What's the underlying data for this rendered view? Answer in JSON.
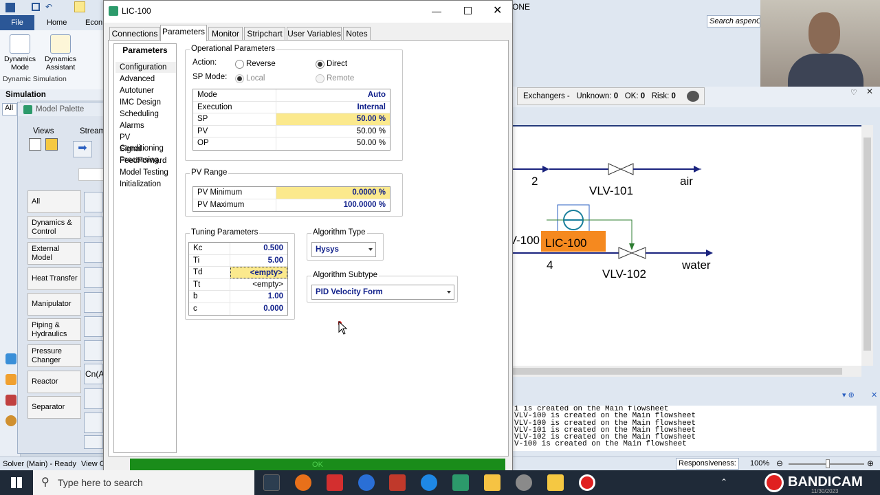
{
  "ribbon": {
    "file_tab": "File",
    "home_tab": "Home",
    "econ_tab": "Econ",
    "dynamics_mode": "Dynamics Mode",
    "dynamics_assistant": "Dynamics Assistant",
    "dynamic_simulation": "Dynamic Simulation"
  },
  "simulation_label": "Simulation",
  "left_filter": "All",
  "palette": {
    "title": "Model Palette",
    "views_label": "Views",
    "streams_label": "Stream",
    "categories": [
      "All",
      "Dynamics & Control",
      "External Model",
      "Heat Transfer",
      "Manipulator",
      "Piping & Hydraulics",
      "Pressure Changer",
      "Reactor",
      "Separator"
    ],
    "cn_label": "Cn(A"
  },
  "status_left": {
    "solver": "Solver (Main) - Ready",
    "view": "View C"
  },
  "app_title_fragment": "ONE",
  "search_box": "Search aspenO",
  "exchangers_bar": {
    "label": "Exchangers -",
    "unknown": "Unknown:",
    "unknown_val": "0",
    "ok": "OK:",
    "ok_val": "0",
    "risk": "Risk:",
    "risk_val": "0"
  },
  "flowsheet": {
    "stream2": "2",
    "vlv101": "VLV-101",
    "air": "air",
    "v100": "V-100",
    "lic100": "LIC-100",
    "stream4": "4",
    "vlv102": "VLV-102",
    "water": "water"
  },
  "messages": [
    "1 is created on the Main flowsheet",
    "VLV-100 is created on the Main flowsheet",
    "VLV-100 is created on the Main flowsheet",
    "VLV-101 is created on the Main flowsheet",
    "VLV-102 is created on the Main flowsheet",
    "V-100 is created on the Main flowsheet"
  ],
  "fs_status": {
    "responsiveness": "Responsiveness: 5",
    "zoom": "100%"
  },
  "dialog": {
    "title": "LIC-100",
    "tabs": [
      "Connections",
      "Parameters",
      "Monitor",
      "Stripchart",
      "User Variables",
      "Notes"
    ],
    "left_title": "Parameters",
    "left_items": [
      "Configuration",
      "Advanced",
      "Autotuner",
      "IMC Design",
      "Scheduling",
      "Alarms",
      "PV Conditioning",
      "Signal Processing",
      "FeedForward",
      "Model Testing",
      "Initialization"
    ],
    "op_params": {
      "title": "Operational Parameters",
      "action_label": "Action:",
      "reverse": "Reverse",
      "direct": "Direct",
      "sp_mode_label": "SP Mode:",
      "local": "Local",
      "remote": "Remote",
      "rows": [
        {
          "k": "Mode",
          "v": "Auto"
        },
        {
          "k": "Execution",
          "v": "Internal"
        },
        {
          "k": "SP",
          "v": "50.00 %"
        },
        {
          "k": "PV",
          "v": "50.00 %"
        },
        {
          "k": "OP",
          "v": "50.00 %"
        }
      ]
    },
    "pv_range": {
      "title": "PV Range",
      "rows": [
        {
          "k": "PV Minimum",
          "v": "0.0000 %"
        },
        {
          "k": "PV Maximum",
          "v": "100.0000 %"
        }
      ]
    },
    "tuning": {
      "title": "Tuning Parameters",
      "rows": [
        {
          "k": "Kc",
          "v": "0.500"
        },
        {
          "k": "Ti",
          "v": "5.00"
        },
        {
          "k": "Td",
          "v": "<empty>"
        },
        {
          "k": "Tt",
          "v": "<empty>"
        },
        {
          "k": "b",
          "v": "1.00"
        },
        {
          "k": "c",
          "v": "0.000"
        }
      ]
    },
    "algo_type": {
      "title": "Algorithm Type",
      "value": "Hysys"
    },
    "algo_subtype": {
      "title": "Algorithm Subtype",
      "value": "PID Velocity Form"
    },
    "ok_text": "OK"
  },
  "taskbar": {
    "search_placeholder": "Type here to search",
    "bandicam": "BANDICAM",
    "date": "11/30/2023"
  }
}
